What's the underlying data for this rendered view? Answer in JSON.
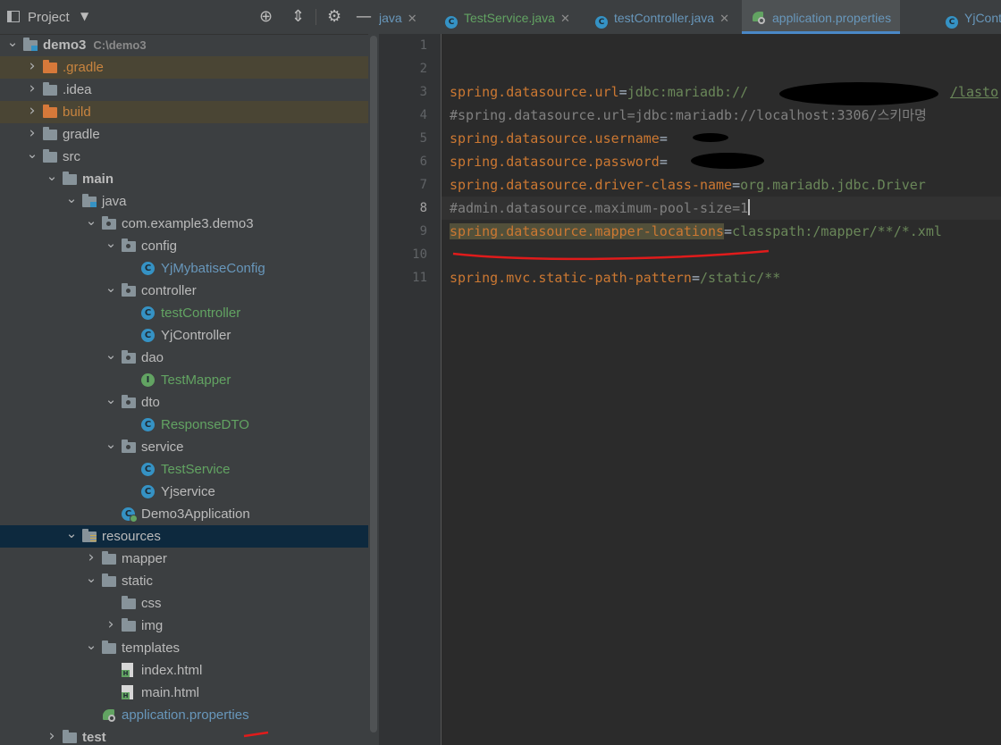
{
  "panel": {
    "title": "Project",
    "tree": [
      {
        "label": "demo3",
        "path": "C:\\demo3",
        "depth": 0,
        "icon": "module",
        "expanded": true,
        "bold": true
      },
      {
        "label": ".gradle",
        "depth": 1,
        "icon": "folder-orange",
        "expanded": false,
        "style": "excluded",
        "hl": true
      },
      {
        "label": ".idea",
        "depth": 1,
        "icon": "folder",
        "expanded": false
      },
      {
        "label": "build",
        "depth": 1,
        "icon": "folder-orange",
        "expanded": false,
        "style": "excluded",
        "hl": true
      },
      {
        "label": "gradle",
        "depth": 1,
        "icon": "folder",
        "expanded": false
      },
      {
        "label": "src",
        "depth": 1,
        "icon": "folder",
        "expanded": true
      },
      {
        "label": "main",
        "depth": 2,
        "icon": "folder",
        "expanded": true,
        "bold": true
      },
      {
        "label": "java",
        "depth": 3,
        "icon": "folder-src",
        "expanded": true
      },
      {
        "label": "com.example3.demo3",
        "depth": 4,
        "icon": "folder-pkg",
        "expanded": true
      },
      {
        "label": "config",
        "depth": 5,
        "icon": "folder-pkg",
        "expanded": true
      },
      {
        "label": "YjMybatiseConfig",
        "depth": 6,
        "icon": "class",
        "style": "java-blue"
      },
      {
        "label": "controller",
        "depth": 5,
        "icon": "folder-pkg",
        "expanded": true
      },
      {
        "label": "testController",
        "depth": 6,
        "icon": "class",
        "style": "java-green"
      },
      {
        "label": "YjController",
        "depth": 6,
        "icon": "class"
      },
      {
        "label": "dao",
        "depth": 5,
        "icon": "folder-pkg",
        "expanded": true
      },
      {
        "label": "TestMapper",
        "depth": 6,
        "icon": "interface",
        "style": "java-green"
      },
      {
        "label": "dto",
        "depth": 5,
        "icon": "folder-pkg",
        "expanded": true
      },
      {
        "label": "ResponseDTO",
        "depth": 6,
        "icon": "class",
        "style": "java-green"
      },
      {
        "label": "service",
        "depth": 5,
        "icon": "folder-pkg",
        "expanded": true
      },
      {
        "label": "TestService",
        "depth": 6,
        "icon": "class",
        "style": "java-green"
      },
      {
        "label": "Yjservice",
        "depth": 6,
        "icon": "class"
      },
      {
        "label": "Demo3Application",
        "depth": 5,
        "icon": "app"
      },
      {
        "label": "resources",
        "depth": 3,
        "icon": "folder-res",
        "expanded": true,
        "selected": true
      },
      {
        "label": "mapper",
        "depth": 4,
        "icon": "folder",
        "expanded": false
      },
      {
        "label": "static",
        "depth": 4,
        "icon": "folder",
        "expanded": true
      },
      {
        "label": "css",
        "depth": 5,
        "icon": "folder"
      },
      {
        "label": "img",
        "depth": 5,
        "icon": "folder",
        "expanded": false
      },
      {
        "label": "templates",
        "depth": 4,
        "icon": "folder",
        "expanded": true
      },
      {
        "label": "index.html",
        "depth": 5,
        "icon": "html"
      },
      {
        "label": "main.html",
        "depth": 5,
        "icon": "html"
      },
      {
        "label": "application.properties",
        "depth": 4,
        "icon": "properties",
        "style": "prop-blue"
      },
      {
        "label": "test",
        "depth": 2,
        "icon": "folder",
        "expanded": false,
        "bold": true
      }
    ]
  },
  "tabs": [
    {
      "label": "java",
      "icon": "none",
      "closable": true
    },
    {
      "label": "TestService.java",
      "icon": "class",
      "closable": true,
      "color": "green"
    },
    {
      "label": "testController.java",
      "icon": "class",
      "closable": true
    },
    {
      "label": "application.properties",
      "icon": "properties",
      "closable": false,
      "active": true
    },
    {
      "label": "YjCont",
      "icon": "class",
      "closable": false
    }
  ],
  "editor": {
    "current_line": 8,
    "lines": [
      {
        "n": "1",
        "parts": []
      },
      {
        "n": "2",
        "parts": []
      },
      {
        "n": "3",
        "parts": [
          {
            "t": "spring.datasource.url",
            "c": "key"
          },
          {
            "t": "=",
            "c": "eq"
          },
          {
            "t": "jdbc:mariadb://",
            "c": "val"
          },
          {
            "t": "                         ",
            "c": "val"
          },
          {
            "t": "/lasto",
            "c": "val under"
          }
        ]
      },
      {
        "n": "4",
        "parts": [
          {
            "t": "#spring.datasource.url=jdbc:mariadb://localhost:3306/스키마명",
            "c": "cmt"
          }
        ]
      },
      {
        "n": "5",
        "parts": [
          {
            "t": "spring.datasource.username",
            "c": "key"
          },
          {
            "t": "=",
            "c": "eq"
          }
        ]
      },
      {
        "n": "6",
        "parts": [
          {
            "t": "spring.datasource.password",
            "c": "key"
          },
          {
            "t": "=",
            "c": "eq"
          }
        ]
      },
      {
        "n": "7",
        "parts": [
          {
            "t": "spring.datasource.driver-class-name",
            "c": "key"
          },
          {
            "t": "=",
            "c": "eq"
          },
          {
            "t": "org.mariadb.jdbc.Driver",
            "c": "val"
          }
        ]
      },
      {
        "n": "8",
        "parts": [
          {
            "t": "#admin.datasource.maximum-pool-size=1",
            "c": "cmt"
          },
          {
            "t": "",
            "c": "caret"
          }
        ]
      },
      {
        "n": "9",
        "parts": [
          {
            "t": "spring.datasource.mapper-locations",
            "c": "keyhl"
          },
          {
            "t": "=",
            "c": "eq"
          },
          {
            "t": "classpath:/mapper/**/*.xml",
            "c": "val"
          }
        ]
      },
      {
        "n": "10",
        "parts": []
      },
      {
        "n": "11",
        "parts": [
          {
            "t": "spring.mvc.static-path-pattern",
            "c": "key"
          },
          {
            "t": "=",
            "c": "eq"
          },
          {
            "t": "/static/**",
            "c": "val"
          }
        ]
      }
    ]
  },
  "annotation_color": "#e01b1b"
}
